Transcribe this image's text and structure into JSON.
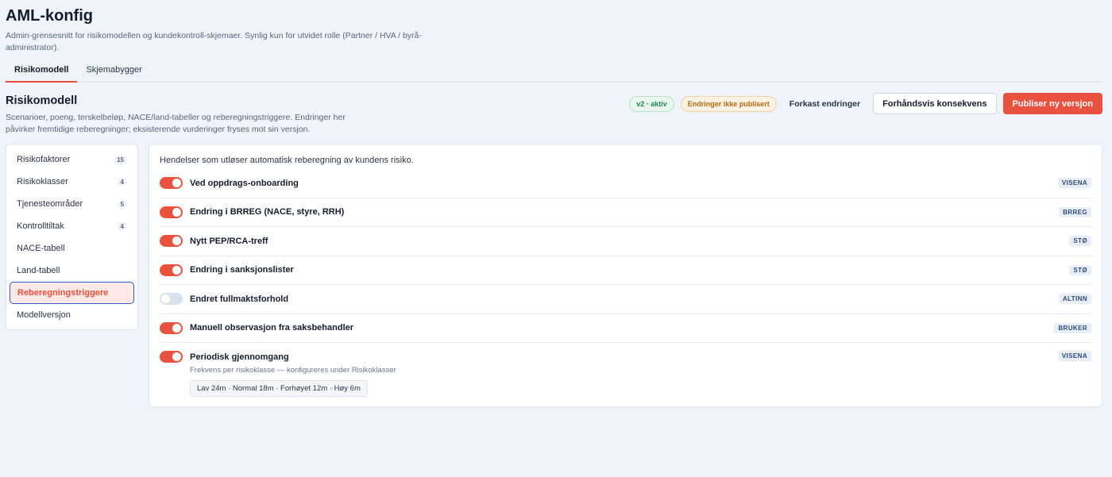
{
  "header": {
    "title": "AML-konfig",
    "subtitle": "Admin-grensesnitt for risikomodellen og kundekontroll-skjemaer. Synlig kun for utvidet rolle (Partner / HVA / byrå-administrator)."
  },
  "tabs": [
    {
      "label": "Risikomodell",
      "active": true
    },
    {
      "label": "Skjemabygger",
      "active": false
    }
  ],
  "section": {
    "title": "Risikomodell",
    "subtitle": "Scenarioer, poeng, terskelbeløp, NACE/land-tabeller og reberegningstriggere. Endringer her påvirker fremtidige reberegninger; eksisterende vurderinger fryses mot sin versjon."
  },
  "actions": {
    "version_badge": "v2 · aktiv",
    "unpublished_badge": "Endringer ikke publisert",
    "discard": "Forkast endringer",
    "preview": "Forhåndsvis konsekvens",
    "publish": "Publiser ny versjon"
  },
  "sidebar": {
    "items": [
      {
        "label": "Risikofaktorer",
        "count": "15"
      },
      {
        "label": "Risikoklasser",
        "count": "4"
      },
      {
        "label": "Tjenesteområder",
        "count": "5"
      },
      {
        "label": "Kontrolltiltak",
        "count": "4"
      },
      {
        "label": "NACE-tabell",
        "count": ""
      },
      {
        "label": "Land-tabell",
        "count": ""
      },
      {
        "label": "Reberegningstriggere",
        "count": "",
        "active": true
      },
      {
        "label": "Modellversjon",
        "count": ""
      }
    ]
  },
  "panel": {
    "intro": "Hendelser som utløser automatisk reberegning av kundens risiko.",
    "triggers": [
      {
        "label": "Ved oppdrags-onboarding",
        "source": "VISENA",
        "enabled": true
      },
      {
        "label": "Endring i BRREG (NACE, styre, RRH)",
        "source": "BRREG",
        "enabled": true
      },
      {
        "label": "Nytt PEP/RCA-treff",
        "source": "STØ",
        "enabled": true
      },
      {
        "label": "Endring i sanksjonslister",
        "source": "STØ",
        "enabled": true
      },
      {
        "label": "Endret fullmaktsforhold",
        "source": "ALTINN",
        "enabled": false
      },
      {
        "label": "Manuell observasjon fra saksbehandler",
        "source": "BRUKER",
        "enabled": true
      },
      {
        "label": "Periodisk gjennomgang",
        "source": "VISENA",
        "enabled": true,
        "sub": "Frekvens per risikoklasse — konfigureres under Risikoklasser",
        "frequency": "Lav 24m · Normal 18m · Forhøyet 12m · Høy 6m"
      }
    ]
  },
  "colors": {
    "accent": "#ea5240",
    "focus": "#2f5bd3",
    "background": "#eff4fb"
  }
}
